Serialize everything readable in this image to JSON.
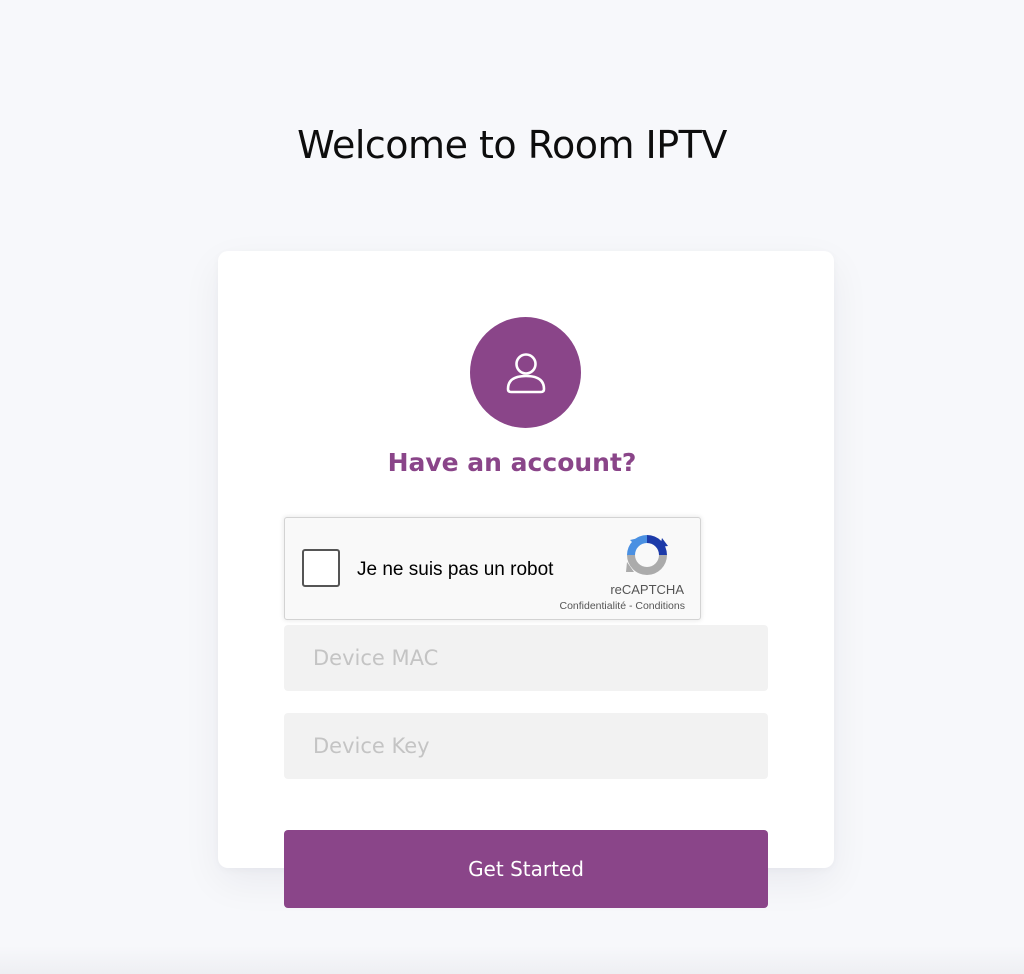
{
  "page": {
    "title": "Welcome to Room IPTV"
  },
  "theme": {
    "accent": "#8a4589",
    "background": "#f7f8fb",
    "card": "#ffffff",
    "field_bg": "#f2f2f2"
  },
  "login_card": {
    "avatar_icon": "user-icon",
    "heading": "Have an account?",
    "recaptcha": {
      "label": "Je ne suis pas un robot",
      "brand": "reCAPTCHA",
      "privacy": "Confidentialité",
      "separator": " - ",
      "terms": "Conditions",
      "icon": "recaptcha-logo-icon"
    },
    "device_mac": {
      "value": "",
      "placeholder": "Device MAC"
    },
    "device_key": {
      "value": "",
      "placeholder": "Device Key"
    },
    "submit_label": "Get Started"
  }
}
